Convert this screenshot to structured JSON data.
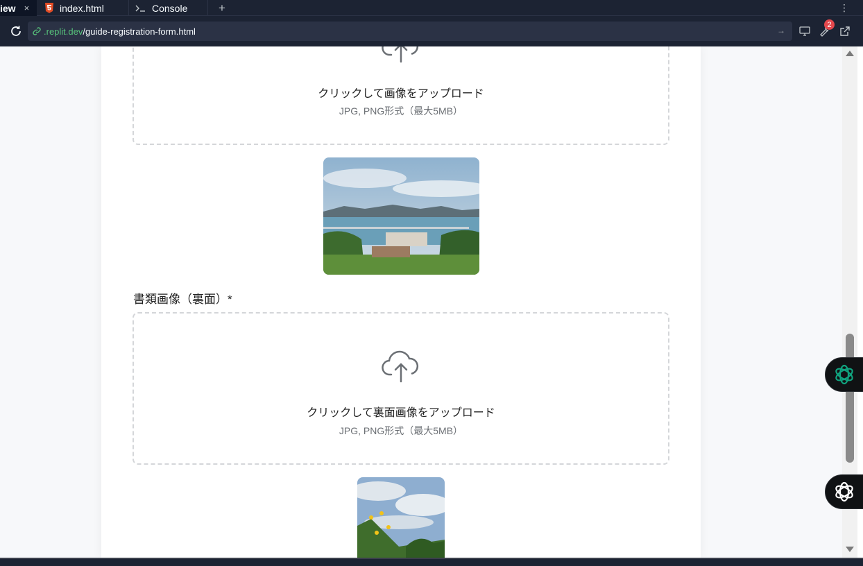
{
  "tabs": [
    {
      "label": "iew",
      "active": true
    },
    {
      "label": "index.html",
      "icon": "html5-icon"
    },
    {
      "label": "Console",
      "icon": "terminal-icon"
    }
  ],
  "tab_close": "×",
  "tab_add": "+",
  "kebab": "⋮",
  "address": {
    "domain": ".replit.dev",
    "path": "/guide-registration-form.html",
    "go": "→"
  },
  "tools_badge": "2",
  "form": {
    "front_upload": {
      "text": "クリックして画像をアップロード",
      "hint": "JPG, PNG形式（最大5MB）"
    },
    "back_label": "書類画像（裏面）*",
    "back_upload": {
      "text": "クリックして裏面画像をアップロード",
      "hint": "JPG, PNG形式（最大5MB）"
    }
  },
  "colors": {
    "chrome_bg": "#1c2333",
    "url_domain": "#58c57c",
    "badge": "#e5484d",
    "dropzone_border": "#d4d6d9",
    "assistant_green": "#10a37f"
  }
}
